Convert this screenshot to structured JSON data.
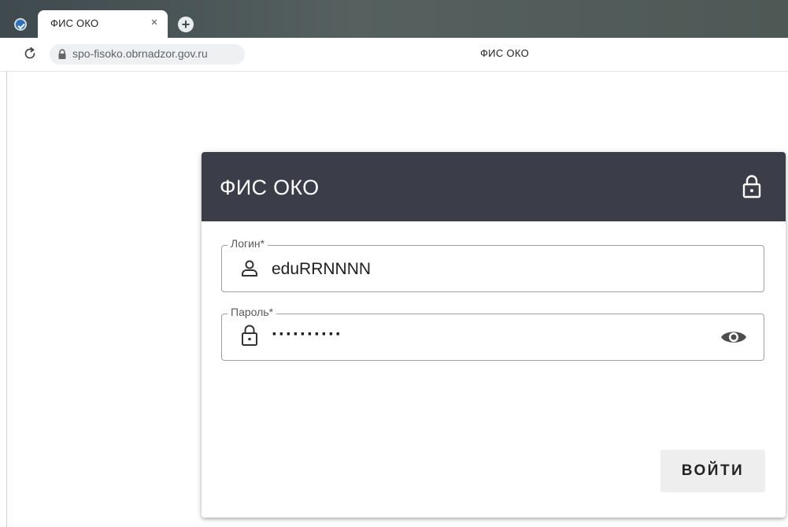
{
  "browser": {
    "tab_title": "ФИС ОКО",
    "tab_close": "×",
    "new_tab": "+",
    "url": "spo-fisoko.obrnadzor.gov.ru",
    "page_title": "ФИС ОКО"
  },
  "login_form": {
    "title": "ФИС ОКО",
    "login_label": "Логин*",
    "login_value": "eduRRNNNN",
    "login_icon": "user-icon",
    "password_label": "Пароль*",
    "password_value": "··········",
    "password_icon": "lock-icon",
    "toggle_icon": "eye-icon",
    "submit_label": "ВОЙТИ",
    "header_icon": "lock-icon"
  },
  "colors": {
    "header_bg": "#3b3e49",
    "tabbar_bg": "#4a5553",
    "button_bg": "#eeeeee"
  }
}
